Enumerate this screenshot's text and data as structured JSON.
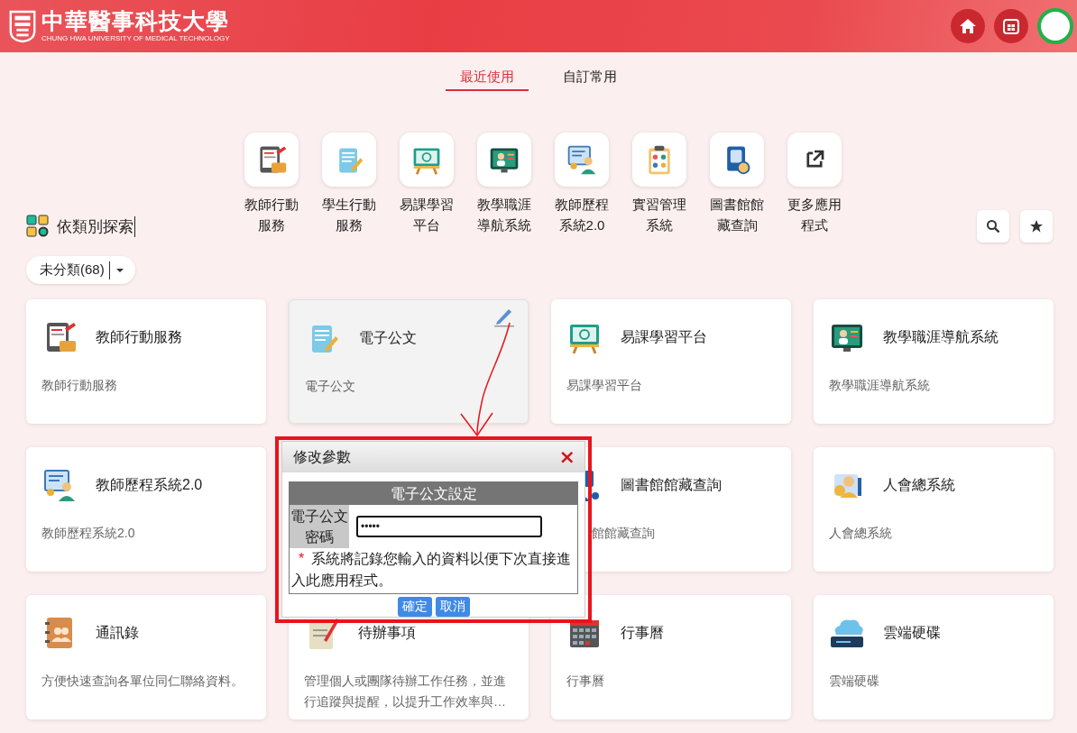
{
  "header": {
    "logo_title": "中華醫事科技大學",
    "logo_subtitle": "CHUNG HWA UNIVERSITY OF MEDICAL TECHNOLOGY"
  },
  "tabs": [
    {
      "label": "最近使用",
      "selected": true
    },
    {
      "label": "自訂常用",
      "selected": false
    }
  ],
  "shortcuts": [
    {
      "label": "教師行動服務"
    },
    {
      "label": "學生行動服務"
    },
    {
      "label": "易課學習平台"
    },
    {
      "label": "教學職涯導航系統"
    },
    {
      "label": "教師歷程系統2.0"
    },
    {
      "label": "實習管理系統"
    },
    {
      "label": "圖書館館藏查詢"
    },
    {
      "label": "更多應用程式"
    }
  ],
  "explore": {
    "title": "依類別探索"
  },
  "category_filter": {
    "label": "未分類(68)"
  },
  "cards": [
    {
      "kind": "card",
      "title": "教師行動服務",
      "description": "教師行動服務",
      "hovered": false
    },
    {
      "kind": "card",
      "title": "電子公文",
      "description": "電子公文",
      "hovered": true
    },
    {
      "kind": "card",
      "title": "易課學習平台",
      "description": "易課學習平台",
      "hovered": false
    },
    {
      "kind": "card",
      "title": "教學職涯導航系統",
      "description": "教學職涯導航系統",
      "hovered": false
    },
    {
      "kind": "card",
      "title": "教師歷程系統2.0",
      "description": "教師歷程系統2.0",
      "hovered": false
    },
    {
      "kind": "covered"
    },
    {
      "kind": "partly_covered",
      "title": "圖書館館藏查詢",
      "description": "館館藏查詢",
      "hovered": false
    },
    {
      "kind": "card",
      "title": "人會總系統",
      "description": "人會總系統",
      "hovered": false
    },
    {
      "kind": "card",
      "title": "通訊錄",
      "description": "方便快速查詢各單位同仁聯絡資料。",
      "hovered": false
    },
    {
      "kind": "card",
      "title": "待辦事項",
      "description": "管理個人或團隊待辦工作任務，並進行追蹤與提醒，以提升工作效率與…",
      "hovered": false
    },
    {
      "kind": "card",
      "title": "行事曆",
      "description": "行事曆",
      "hovered": false
    },
    {
      "kind": "card",
      "title": "雲端硬碟",
      "description": "雲端硬碟",
      "hovered": false
    }
  ],
  "dialog": {
    "title": "修改參數",
    "close": "×",
    "table_title": "電子公文設定",
    "field_label": "電子公文密碼",
    "password": {
      "value": "•••••"
    },
    "note_mark": "*",
    "note": "系統將記錄您輸入的資料以便下次直接進入此應用程式。",
    "buttons": [
      "確定",
      "取消"
    ]
  }
}
